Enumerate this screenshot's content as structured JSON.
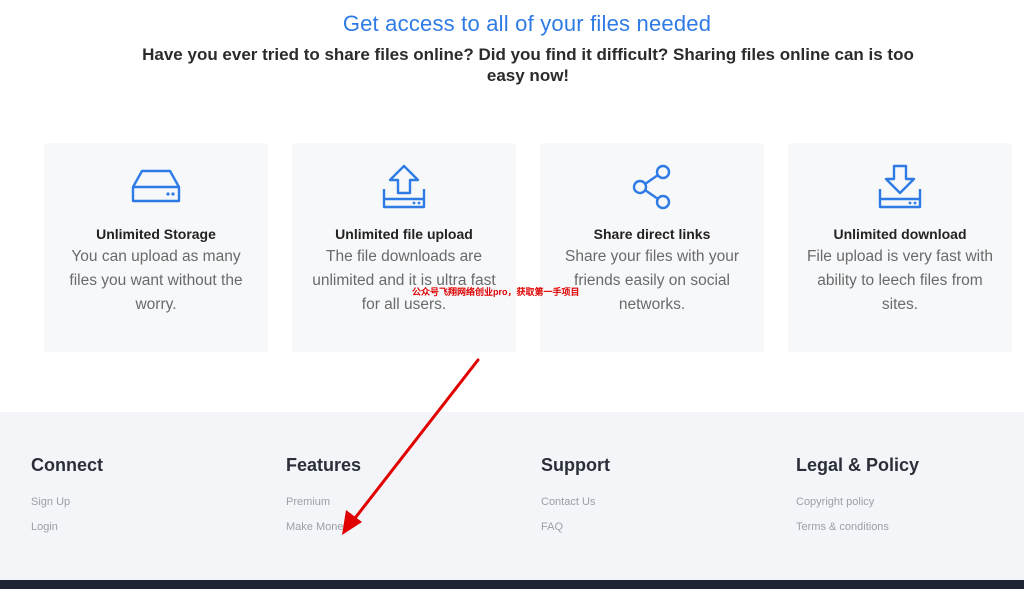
{
  "hero": {
    "title": "Get access to all of your files needed",
    "subtitle": "Have you ever tried to share files online? Did you find it difficult? Sharing files online can is too easy now!"
  },
  "features": [
    {
      "icon": "storage-drive-icon",
      "title": "Unlimited Storage",
      "desc": "You can upload as many files you want without the worry."
    },
    {
      "icon": "upload-icon",
      "title": "Unlimited file upload",
      "desc": "The file downloads are unlimited and it is ultra fast for all users."
    },
    {
      "icon": "share-icon",
      "title": "Share direct links",
      "desc": "Share your files with your friends easily on social networks."
    },
    {
      "icon": "download-icon",
      "title": "Unlimited download",
      "desc": "File upload is very fast with ability to leech files from sites."
    }
  ],
  "footer": {
    "connect": {
      "heading": "Connect",
      "links": [
        "Sign Up",
        "Login"
      ]
    },
    "features": {
      "heading": "Features",
      "links": [
        "Premium",
        "Make Money"
      ]
    },
    "support": {
      "heading": "Support",
      "links": [
        "Contact Us",
        "FAQ"
      ]
    },
    "legal": {
      "heading": "Legal & Policy",
      "links": [
        "Copyright policy",
        "Terms & conditions"
      ]
    }
  },
  "watermark": "公众号飞翔网络创业pro，获取第一手项目",
  "colors": {
    "accent": "#2f7be5",
    "annotation": "#e00000"
  }
}
